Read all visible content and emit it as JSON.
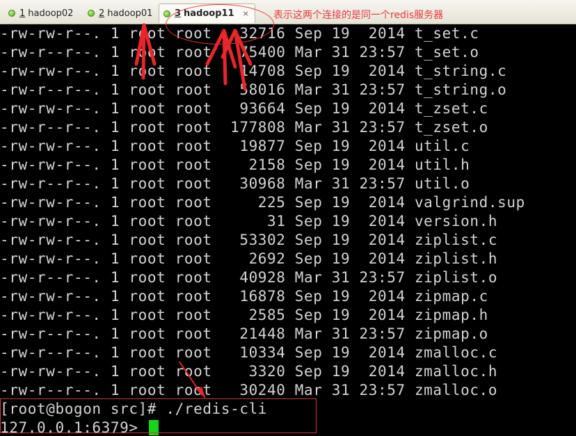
{
  "tabs": [
    {
      "num": "1",
      "label": "hadoop02"
    },
    {
      "num": "2",
      "label": "hadoop01"
    },
    {
      "num": "3",
      "label": "hadoop11",
      "close": "×"
    }
  ],
  "annotation": "表示这两个连接的是同一个redis服务器",
  "listing": [
    "-rw-rw-r--. 1 root root   32716 Sep 19  2014 t_set.c",
    "-rw-r--r--. 1 root root   75400 Mar 31 23:57 t_set.o",
    "-rw-rw-r--. 1 root root   14708 Sep 19  2014 t_string.c",
    "-rw-r--r--. 1 root root   58016 Mar 31 23:57 t_string.o",
    "-rw-rw-r--. 1 root root   93664 Sep 19  2014 t_zset.c",
    "-rw-r--r--. 1 root root  177808 Mar 31 23:57 t_zset.o",
    "-rw-rw-r--. 1 root root   19877 Sep 19  2014 util.c",
    "-rw-rw-r--. 1 root root    2158 Sep 19  2014 util.h",
    "-rw-r--r--. 1 root root   30968 Mar 31 23:57 util.o",
    "-rw-rw-r--. 1 root root     225 Sep 19  2014 valgrind.sup",
    "-rw-rw-r--. 1 root root      31 Sep 19  2014 version.h",
    "-rw-rw-r--. 1 root root   53302 Sep 19  2014 ziplist.c",
    "-rw-rw-r--. 1 root root    2692 Sep 19  2014 ziplist.h",
    "-rw-r--r--. 1 root root   40928 Mar 31 23:57 ziplist.o",
    "-rw-rw-r--. 1 root root   16878 Sep 19  2014 zipmap.c",
    "-rw-rw-r--. 1 root root    2585 Sep 19  2014 zipmap.h",
    "-rw-r--r--. 1 root root   21448 Mar 31 23:57 zipmap.o",
    "-rw-r--r--. 1 root root   10334 Sep 19  2014 zmalloc.c",
    "-rw-rw-r--. 1 root root    3320 Sep 19  2014 zmalloc.h",
    "-rw-r--r--. 1 root root   30240 Mar 31 23:57 zmalloc.o"
  ],
  "command_line": "[root@bogon src]# ./redis-cli",
  "cli_prompt": "127.0.0.1:6379> ",
  "colors": {
    "annotation": "#e53a3a",
    "cursor": "#17d517",
    "text": "#d4d4d4"
  }
}
